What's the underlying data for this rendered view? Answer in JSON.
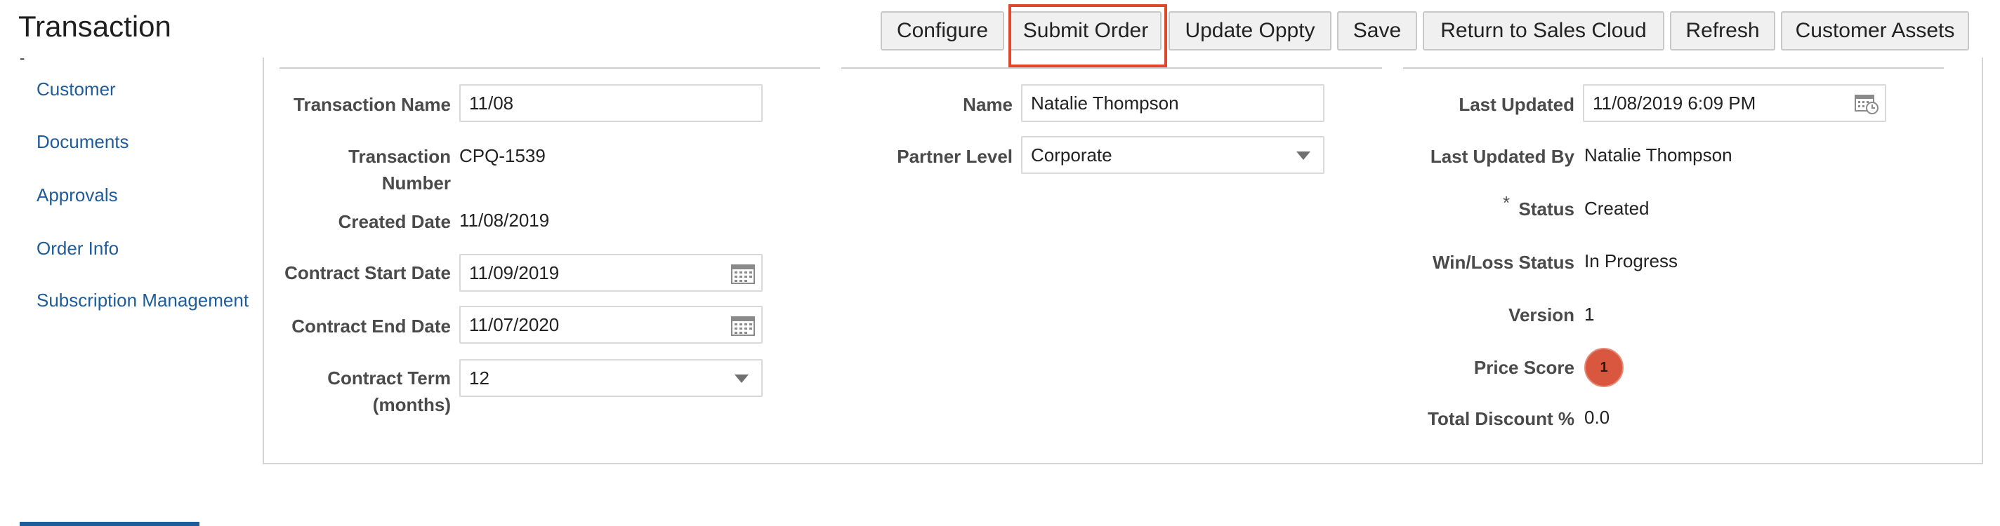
{
  "page": {
    "title": "Transaction",
    "dash": "-"
  },
  "toolbar": {
    "buttons": [
      {
        "label": "Configure"
      },
      {
        "label": "Submit Order"
      },
      {
        "label": "Update Oppty"
      },
      {
        "label": "Save"
      },
      {
        "label": "Return to Sales Cloud"
      },
      {
        "label": "Refresh"
      },
      {
        "label": "Customer Assets"
      }
    ]
  },
  "nav": {
    "items": [
      {
        "label": "Customer"
      },
      {
        "label": "Documents"
      },
      {
        "label": "Approvals"
      },
      {
        "label": "Order Info"
      },
      {
        "label": "Subscription Management"
      }
    ]
  },
  "col1": {
    "transaction_name": {
      "label": "Transaction Name",
      "value": "11/08"
    },
    "transaction_number": {
      "label_line1": "Transaction",
      "label_line2": "Number",
      "value": "CPQ-1539"
    },
    "created_date": {
      "label": "Created Date",
      "value": "11/08/2019"
    },
    "contract_start": {
      "label": "Contract Start Date",
      "value": "11/09/2019"
    },
    "contract_end": {
      "label": "Contract End Date",
      "value": "11/07/2020"
    },
    "contract_term": {
      "label_line1": "Contract Term",
      "label_line2": "(months)",
      "value": "12"
    }
  },
  "col2": {
    "name": {
      "label": "Name",
      "value": "Natalie Thompson"
    },
    "partner_level": {
      "label": "Partner Level",
      "value": "Corporate"
    }
  },
  "col3": {
    "last_updated": {
      "label": "Last Updated",
      "value": "11/08/2019 6:09 PM"
    },
    "last_updated_by": {
      "label": "Last Updated By",
      "value": "Natalie Thompson"
    },
    "status": {
      "required_mark": "*",
      "label": "Status",
      "value": "Created"
    },
    "win_loss": {
      "label": "Win/Loss Status",
      "value": "In Progress"
    },
    "version": {
      "label": "Version",
      "value": "1"
    },
    "price_score": {
      "label": "Price Score",
      "value": "1",
      "color": "#d9573f"
    },
    "total_discount": {
      "label": "Total Discount %",
      "value": "0.0"
    }
  },
  "colors": {
    "link": "#1f5c9a",
    "highlight": "#e0462b",
    "border": "#d4d4d4"
  },
  "icons": {
    "calendar": "calendar-icon",
    "calendar_clock": "calendar-clock-icon",
    "dropdown": "chevron-down-icon"
  }
}
